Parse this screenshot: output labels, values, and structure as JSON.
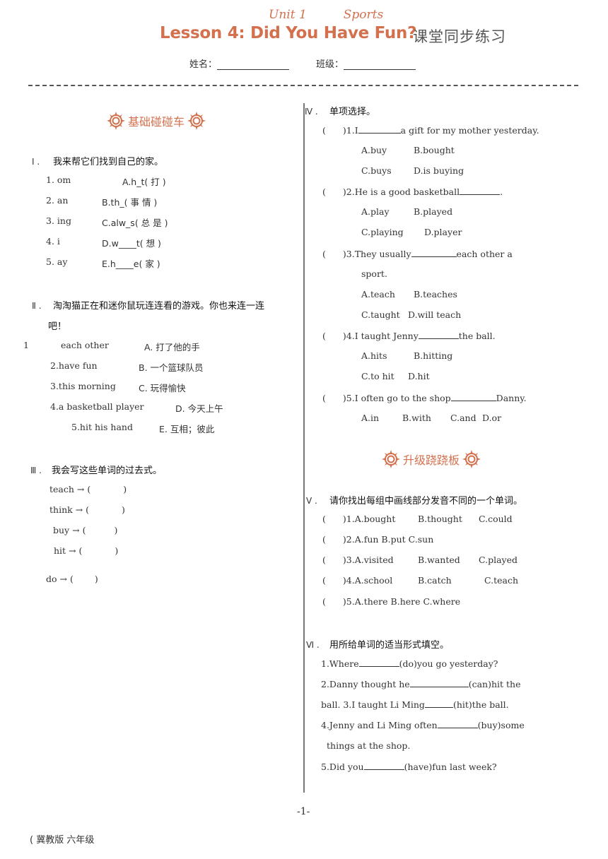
{
  "header": {
    "unit": "Unit 1",
    "topic": "Sports",
    "title": "Lesson 4: Did You Have Fun?",
    "title_cn": "课堂同步练习",
    "name_label": "姓名：",
    "class_label": "班级："
  },
  "banners": {
    "basic": "基础碰碰车",
    "advanced": "升级跷跷板"
  },
  "section1": {
    "num": "Ⅰ .",
    "title": "我来帮它们找到自己的家。",
    "items": [
      {
        "left": "1.  om",
        "right": "A.h_t( 打 )"
      },
      {
        "left": "2.  an",
        "right": "B.th_( 事 情 )"
      },
      {
        "left": "3.  ing",
        "right": "C.alw_s( 总 是 )"
      },
      {
        "left": "4.  i",
        "right": "D.w____t( 想 )"
      },
      {
        "left": "5.  ay",
        "right": "E.h____e( 家 )"
      }
    ]
  },
  "section2": {
    "num": "Ⅱ .",
    "title": "淘淘猫正在和迷你鼠玩连连看的游戏。你也来连一连",
    "title_cont": "吧！",
    "items": [
      {
        "prefix": "1",
        "left": "each other",
        "right": "A. 打了他的手"
      },
      {
        "prefix": "",
        "left": "2.have fun",
        "right": "B. 一个篮球队员"
      },
      {
        "prefix": "",
        "left": "3.this morning",
        "right": "C. 玩得愉快"
      },
      {
        "prefix": "",
        "left": "4.a basketball player",
        "right": "D. 今天上午"
      },
      {
        "prefix": "",
        "left": "5.hit his hand",
        "right": "E. 互相；彼此"
      }
    ]
  },
  "section3": {
    "num": "Ⅲ .",
    "title": "我会写这些单词的过去式。",
    "items": [
      {
        "word": "teach",
        "arrow": "→",
        "open": "(",
        "close": ")"
      },
      {
        "word": "think",
        "arrow": "→",
        "open": "(",
        "close": ")"
      },
      {
        "word": "buy",
        "arrow": "→",
        "open": "(",
        "close": ")"
      },
      {
        "word": "hit",
        "arrow": "→",
        "open": "(",
        "close": ")"
      },
      {
        "word": "do",
        "arrow": "→",
        "open": "(",
        "close": ")"
      }
    ]
  },
  "section4": {
    "num": "Ⅳ .",
    "title": "单项选择。",
    "questions": [
      {
        "stem_a": ")1.I",
        "stem_b": "a gift for my mother yesterday.",
        "opts1": [
          "A.buy",
          "B.bought"
        ],
        "opts2": [
          "C.buys",
          "D.is buying"
        ]
      },
      {
        "stem_a": ")2.He is a good basketball",
        "stem_b": ".",
        "opts1": [
          "A.play",
          "B.played"
        ],
        "opts2": [
          "C.playing",
          "D.player"
        ]
      },
      {
        "stem_a": ")3.They usually",
        "stem_b": "each other a",
        "cont": "sport.",
        "opts1": [
          "A.teach",
          "B.teaches"
        ],
        "opts2": [
          "C.taught",
          "D.will teach"
        ]
      },
      {
        "stem_a": ")4.I taught Jenny",
        "stem_b": "the ball.",
        "opts1": [
          "A.hits",
          "B.hitting"
        ],
        "opts2": [
          "C.to hit",
          "D.hit"
        ]
      },
      {
        "stem_a": ")5.I often go to the shop",
        "stem_b": "Danny.",
        "opts1": [
          "A.in",
          "B.with",
          "C.and",
          "D.or"
        ]
      }
    ]
  },
  "section5": {
    "num": "Ⅴ .",
    "title": "请你找出每组中画线部分发音不同的一个单词。",
    "items": [
      {
        "n": ")1.",
        "a": "A.bought",
        "b": "B.thought",
        "c": "C.could"
      },
      {
        "n": ")2.",
        "a": "A.fun",
        "b": "B.put",
        "c": "C.sun"
      },
      {
        "n": ")3.",
        "a": "A.visited",
        "b": "B.wanted",
        "c": "C.played"
      },
      {
        "n": ")4.",
        "a": "A.school",
        "b": "B.catch",
        "c": "C.teach"
      },
      {
        "n": ")5.",
        "a": "A.there",
        "b": "B.here",
        "c": "C.where"
      }
    ]
  },
  "section6": {
    "num": "Ⅵ .",
    "title": "用所给单词的适当形式填空。",
    "lines": [
      {
        "a": "1.Where",
        "b": "(do)you go yesterday?"
      },
      {
        "a": "2.Danny thought he",
        "b": "(can)hit the"
      },
      {
        "a": "ball. 3.I taught Li Ming",
        "b": "(hit)the ball."
      },
      {
        "a": "4.Jenny and Li Ming often",
        "b": "(buy)some"
      },
      {
        "a": "things at the shop.",
        "b": ""
      },
      {
        "a": "5.Did you",
        "b": "(have)fun last week?"
      }
    ]
  },
  "footer": {
    "page": "-1-",
    "note": "( 冀教版 六年级"
  },
  "colors": {
    "accent": "#d3714e",
    "text": "#333333"
  }
}
